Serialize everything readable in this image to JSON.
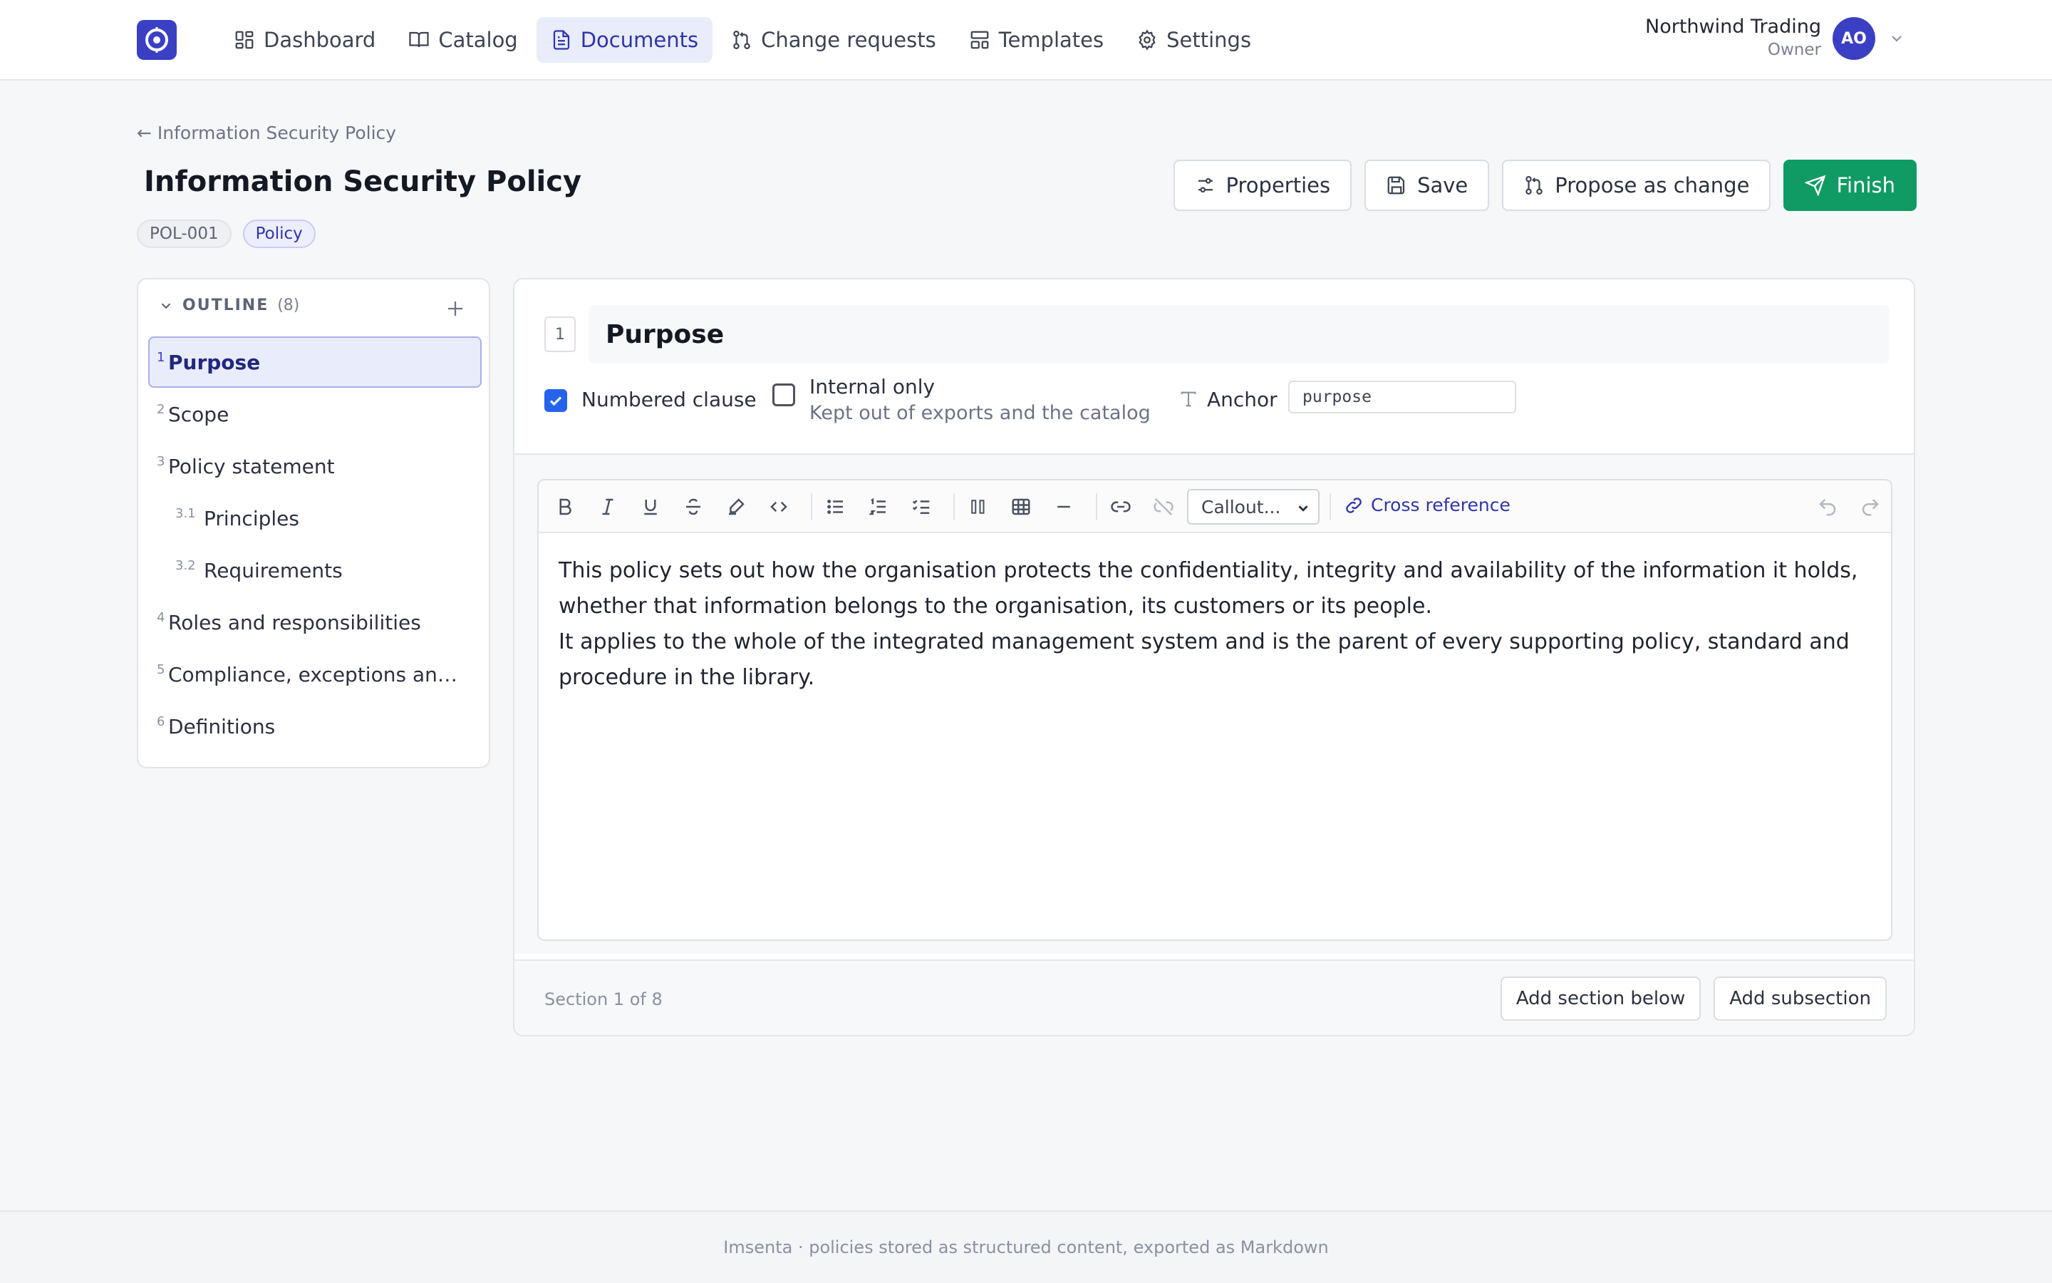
{
  "app": {
    "logo": "logo-icon",
    "footer_text": "Imsenta · policies stored as structured content, exported as Markdown"
  },
  "nav": {
    "items": [
      {
        "label": "Dashboard",
        "icon": "dashboard-icon"
      },
      {
        "label": "Catalog",
        "icon": "book-icon"
      },
      {
        "label": "Documents",
        "icon": "document-icon",
        "active": true
      },
      {
        "label": "Change requests",
        "icon": "git-pull-request-icon"
      },
      {
        "label": "Templates",
        "icon": "template-icon"
      },
      {
        "label": "Settings",
        "icon": "gear-icon"
      }
    ]
  },
  "user": {
    "org": "Northwind Trading",
    "role": "Owner",
    "initials": "AO"
  },
  "header": {
    "breadcrumb": "← Information Security Policy",
    "title": "Information Security Policy",
    "badges": [
      "POL-001",
      "Policy"
    ],
    "actions": {
      "properties": "Properties",
      "save": "Save",
      "propose": "Propose as change",
      "finish": "Finish"
    }
  },
  "outline": {
    "heading": "OUTLINE",
    "count": "(8)",
    "items": [
      {
        "num": "1",
        "label": "Purpose",
        "active": true
      },
      {
        "num": "2",
        "label": "Scope"
      },
      {
        "num": "3",
        "label": "Policy statement"
      },
      {
        "num": "3.1",
        "label": "Principles",
        "sub": true
      },
      {
        "num": "3.2",
        "label": "Requirements",
        "sub": true
      },
      {
        "num": "4",
        "label": "Roles and responsibilities"
      },
      {
        "num": "5",
        "label": "Compliance, exceptions and e..."
      },
      {
        "num": "6",
        "label": "Definitions"
      }
    ]
  },
  "section": {
    "number": "1",
    "title": "Purpose",
    "numbered_clause": {
      "label": "Numbered clause",
      "checked": true
    },
    "internal_only": {
      "label": "Internal only",
      "help": "Kept out of exports and the catalog",
      "checked": false
    },
    "anchor": {
      "label": "Anchor",
      "value": "purpose"
    },
    "toolbar": {
      "callout": "Callout...",
      "cross_reference": "Cross reference"
    },
    "body": [
      "This policy sets out how the organisation protects the confidentiality, integrity and availability of the information it holds, whether that information belongs to the organisation, its customers or its people.",
      "It applies to the whole of the integrated management system and is the parent of every supporting policy, standard and procedure in the library."
    ],
    "footer": {
      "position": "Section 1 of 8",
      "add_below": "Add section below",
      "add_sub": "Add subsection"
    }
  },
  "colors": {
    "accent": "#3b3fc4",
    "primary_button": "#0f9b63",
    "checkbox": "#2563eb"
  }
}
